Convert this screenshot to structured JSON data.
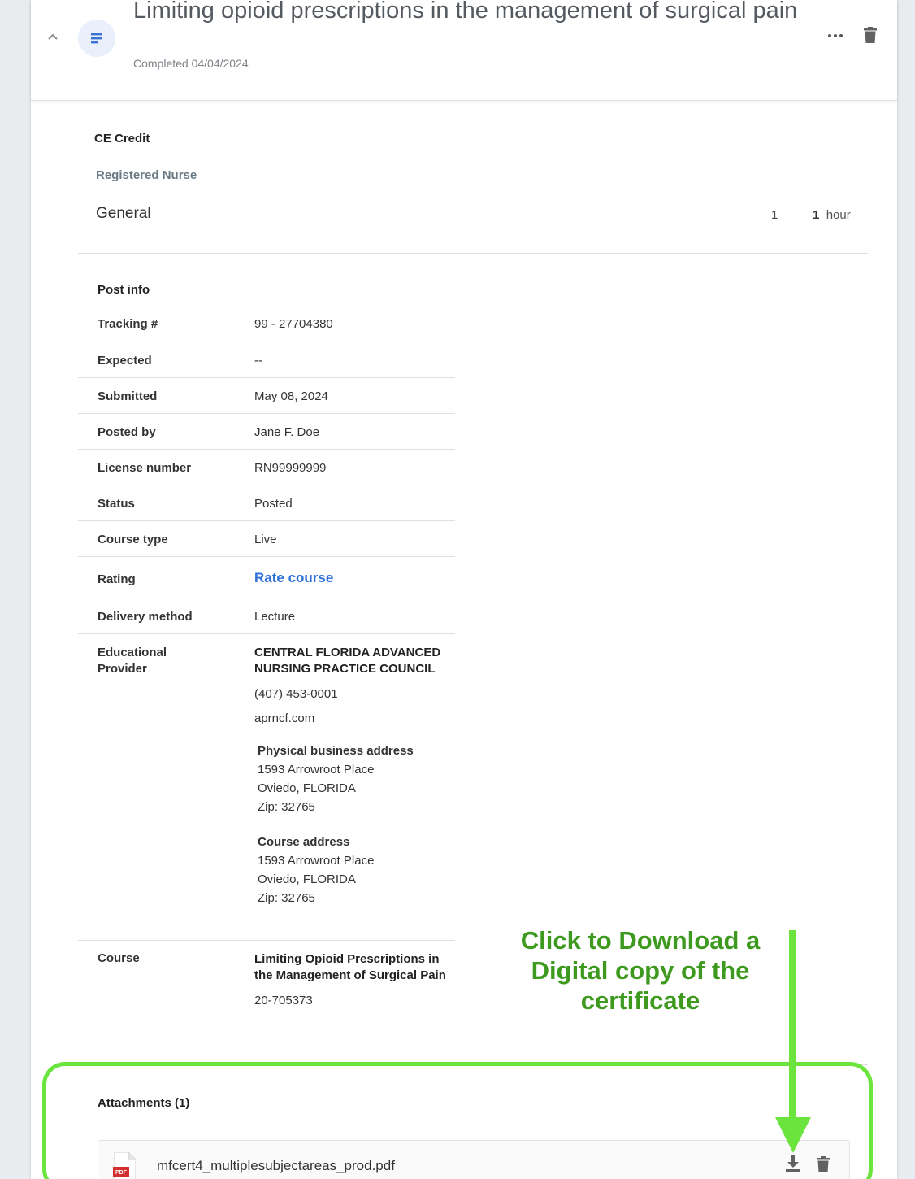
{
  "header": {
    "title": "Limiting opioid prescriptions in the management of surgical pain",
    "subtitle": "Completed 04/04/2024"
  },
  "ce_credit": {
    "label": "CE Credit",
    "role": "Registered Nurse",
    "rows": [
      {
        "name": "General",
        "count": "1",
        "hours_value": "1",
        "hours_unit": "hour"
      }
    ]
  },
  "post_info": {
    "label": "Post info",
    "tracking_label": "Tracking #",
    "tracking_value": "99 - 27704380",
    "expected_label": "Expected",
    "expected_value": "--",
    "submitted_label": "Submitted",
    "submitted_value": "May 08, 2024",
    "posted_by_label": "Posted by",
    "posted_by_value": "Jane F. Doe",
    "license_label": "License number",
    "license_value": "RN99999999",
    "status_label": "Status",
    "status_value": "Posted",
    "course_type_label": "Course type",
    "course_type_value": "Live",
    "rating_label": "Rating",
    "rating_value": "Rate course",
    "delivery_label": "Delivery method",
    "delivery_value": "Lecture",
    "provider_label": "Educational Provider",
    "provider": {
      "name": "CENTRAL FLORIDA ADVANCED NURSING PRACTICE COUNCIL",
      "phone": "(407) 453-0001",
      "website": "aprncf.com",
      "physical_heading": "Physical business address",
      "physical_street": "1593 Arrowroot Place",
      "physical_city": "Oviedo, FLORIDA",
      "physical_zip": "Zip: 32765",
      "course_heading": "Course address",
      "course_street": "1593 Arrowroot Place",
      "course_city": "Oviedo, FLORIDA",
      "course_zip": "Zip: 32765"
    },
    "course_label": "Course",
    "course_name": "Limiting Opioid Prescriptions in the Management of Surgical Pain",
    "course_id": "20-705373"
  },
  "attachments": {
    "label": "Attachments (1)",
    "items": [
      {
        "file_name": "mfcert4_multiplesubjectareas_prod.pdf",
        "badge": "PDF"
      }
    ]
  },
  "annotation": {
    "text": "Click to Download a Digital copy of the certificate",
    "color": "#3d9a1f",
    "outline_color": "#6be53d"
  },
  "colors": {
    "link": "#2f6fd6",
    "icon_gray": "#616161",
    "pdf_red": "#d32f2f",
    "badge_bg": "#e9f0fb"
  }
}
